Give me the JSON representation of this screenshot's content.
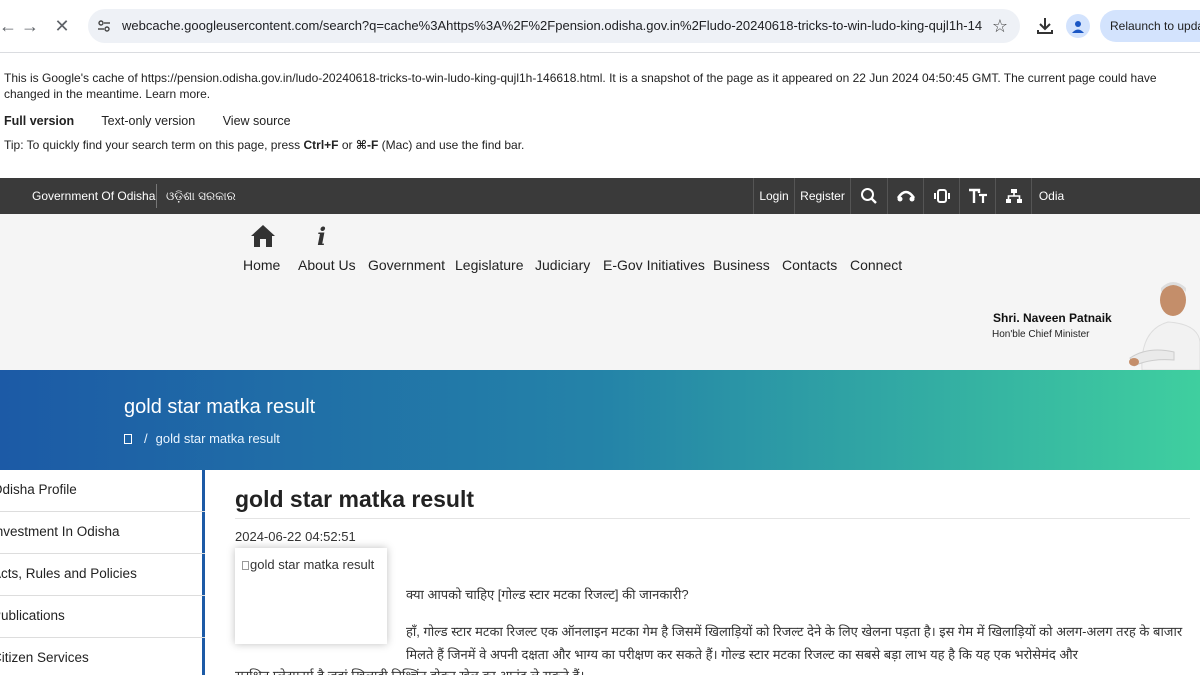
{
  "browser": {
    "url": "webcache.googleusercontent.com/search?q=cache%3Ahttps%3A%2F%2Fpension.odisha.gov.in%2Fludo-20240618-tricks-to-win-ludo-king-qujl1h-14...",
    "relaunch_label": "Relaunch to update"
  },
  "cache_banner": {
    "message": "This is Google's cache of https://pension.odisha.gov.in/ludo-20240618-tricks-to-win-ludo-king-qujl1h-146618.html. It is a snapshot of the page as it appeared on 22 Jun 2024 04:50:45 GMT. The current page could have changed in the meantime. Learn more.",
    "full_version": "Full version",
    "text_only": "Text-only version",
    "view_source": "View source",
    "tip_prefix": "Tip: To quickly find your search term on this page, press ",
    "tip_key1": "Ctrl+F",
    "tip_or": " or ",
    "tip_key2": "⌘-F",
    "tip_suffix": " (Mac) and use the find bar."
  },
  "gov_bar": {
    "government_en": "Government Of Odisha",
    "government_od": "ଓଡ଼ିଶା ସରକାର",
    "login": "Login",
    "register": "Register",
    "language": "Odia"
  },
  "main_nav": {
    "items": [
      "Home",
      "About Us",
      "Government",
      "Legislature",
      "Judiciary",
      "E-Gov Initiatives",
      "Business",
      "Contacts",
      "Connect"
    ]
  },
  "chief_minister": {
    "name": "Shri. Naveen Patnaik",
    "title": "Hon'ble Chief Minister"
  },
  "hero": {
    "title": "gold star matka result",
    "breadcrumb_sep": "/",
    "breadcrumb_current": "gold star matka result"
  },
  "sidebar": {
    "items": [
      "Odisha Profile",
      "Investment In Odisha",
      "Acts, Rules and Policies",
      "Publications",
      "Citizen Services"
    ]
  },
  "article": {
    "title": "gold star matka result",
    "date": "2024-06-22 04:52:51",
    "image_alt": "gold star matka result",
    "p1": "क्या आपको चाहिए [गोल्ड स्टार मटका रिजल्ट] की जानकारी?",
    "p2": "हाँ, गोल्ड स्टार मटका रिजल्ट एक ऑनलाइन मटका गेम है जिसमें खिलाड़ियों को रिजल्ट देने के लिए खेलना पड़ता है। इस गेम में खिलाड़ियों को अलग-अलग तरह के बाजार मिलते हैं जिनमें वे अपनी दक्षता और भाग्य का परीक्षण कर सकते हैं। गोल्ड स्टार मटका रिजल्ट का सबसे बड़ा लाभ यह है कि यह एक भरोसेमंद और",
    "p3": "सुरक्षित प्लेटफार्म है जहां खिलाड़ी निश्चिंत होकर खेल का आनंद ले सकते हैं।"
  },
  "colors": {
    "gov_bar": "#3a3a3a",
    "hero_start": "#1c5aa6",
    "hero_end": "#3fcf9f",
    "sidebar_border": "#1c5aa6"
  }
}
